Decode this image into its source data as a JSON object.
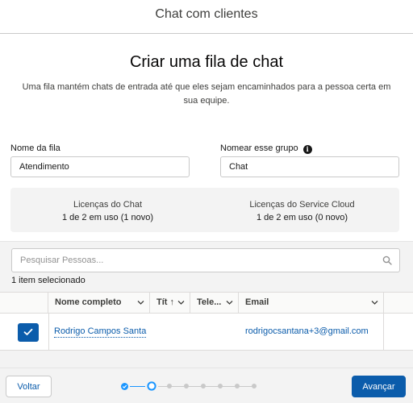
{
  "header": {
    "title": "Chat com clientes"
  },
  "main": {
    "heading": "Criar uma fila de chat",
    "description": "Uma fila mantém chats de entrada até que eles sejam encaminhados para a pessoa certa em sua equipe."
  },
  "form": {
    "queue_name_label": "Nome da fila",
    "queue_name_value": "Atendimento",
    "group_name_label": "Nomear esse grupo",
    "group_name_value": "Chat"
  },
  "licenses": {
    "chat_title": "Licenças do Chat",
    "chat_usage": "1 de 2 em uso (1 novo)",
    "service_title": "Licenças do Service Cloud",
    "service_usage": "1 de 2 em uso (0 novo)"
  },
  "people": {
    "search_placeholder": "Pesquisar Pessoas...",
    "selected_count": "1 item selecionado",
    "columns": {
      "name": "Nome completo",
      "title": "Tít",
      "phone": "Tele...",
      "email": "Email"
    },
    "rows": [
      {
        "name": "Rodrigo Campos Santa",
        "email": "rodrigocsantana+3@gmail.com",
        "selected": true
      }
    ]
  },
  "footer": {
    "back_label": "Voltar",
    "next_label": "Avançar",
    "steps_total": 8,
    "current_step": 2
  },
  "colors": {
    "brand": "#0b5cab",
    "step_done": "#1b96ff",
    "border": "#c9c9c9",
    "panel": "#f3f3f3"
  },
  "icons": [
    "info-icon",
    "search-icon",
    "sort-up-icon",
    "chevron-down-icon",
    "checkmark-icon",
    "step-complete-icon",
    "step-current-icon"
  ]
}
